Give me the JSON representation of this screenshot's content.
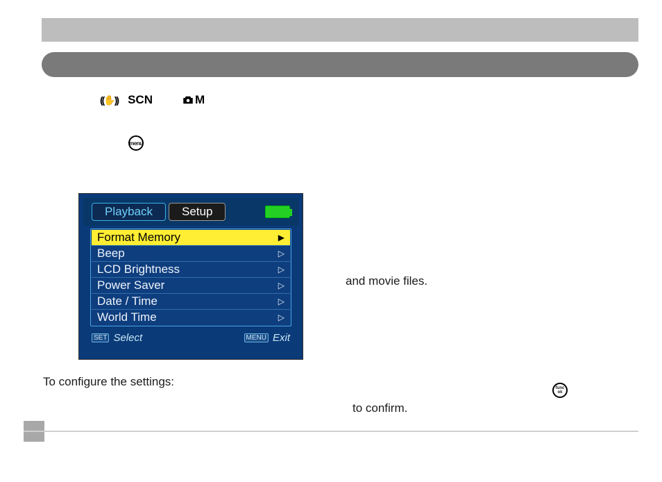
{
  "topbar": "",
  "title_bar": "",
  "modes": {
    "scn": "SCN",
    "m": "M"
  },
  "menu_button_label": "menu",
  "func_button_top": "func",
  "func_button_bottom": "ok",
  "movie_fragment": "and movie files.",
  "configure_text": "To configure the settings:",
  "confirm_fragment": "to confirm.",
  "lcd": {
    "tabs": {
      "playback": "Playback",
      "setup": "Setup"
    },
    "items": [
      "Format Memory",
      "Beep",
      "LCD Brightness",
      "Power Saver",
      "Date / Time",
      "World Time"
    ],
    "selected_index": 0,
    "footer": {
      "select_key": "SET",
      "select_label": "Select",
      "exit_key": "MENU",
      "exit_label": "Exit"
    }
  }
}
